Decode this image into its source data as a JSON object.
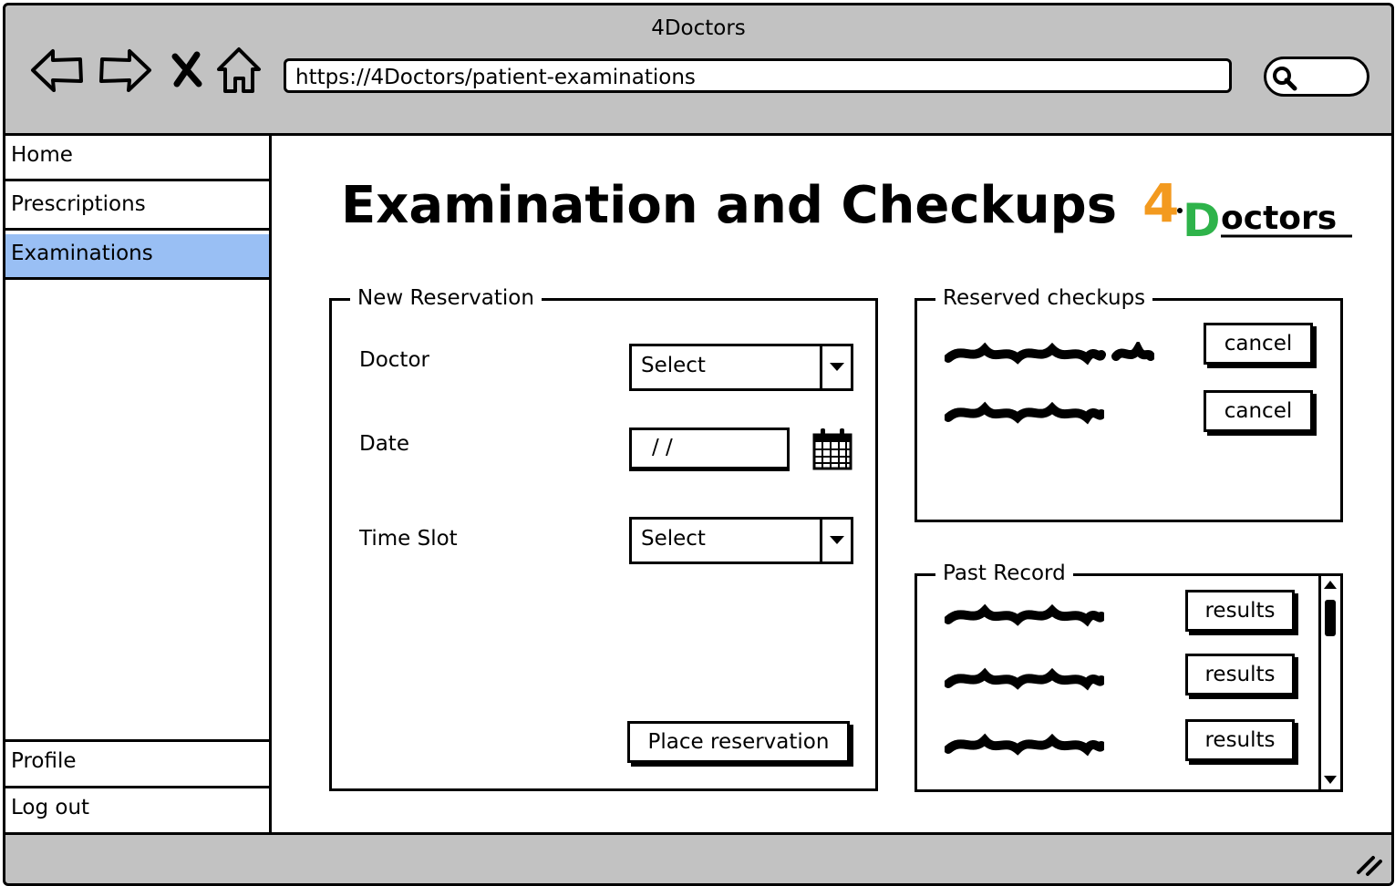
{
  "window": {
    "title": "4Doctors"
  },
  "browser": {
    "url": "https://4Doctors/patient-examinations",
    "nav_icons": [
      "back-arrow-icon",
      "forward-arrow-icon",
      "stop-icon",
      "home-icon"
    ],
    "search_icon": "search-icon"
  },
  "sidebar": {
    "items": [
      {
        "label": "Home",
        "active": false
      },
      {
        "label": "Prescriptions",
        "active": false
      },
      {
        "label": "Examinations",
        "active": true
      }
    ],
    "bottom_items": [
      {
        "label": "Profile"
      },
      {
        "label": "Log out"
      }
    ],
    "active_color": "#99bff4"
  },
  "page": {
    "title": "Examination and Checkups"
  },
  "logo": {
    "digit": "4",
    "letter": "D",
    "rest": "octors",
    "colors": {
      "digit": "#f39a1f",
      "letter": "#2eb34a",
      "rest": "#000000"
    }
  },
  "new_reservation": {
    "legend": "New Reservation",
    "doctor_label": "Doctor",
    "doctor_value": "Select",
    "date_label": "Date",
    "date_value": "/ /",
    "time_label": "Time Slot",
    "time_value": "Select",
    "submit_label": "Place reservation"
  },
  "reserved_checkups": {
    "legend": "Reserved checkups",
    "cancel_labels": [
      "cancel",
      "cancel"
    ]
  },
  "past_record": {
    "legend": "Past Record",
    "result_labels": [
      "results",
      "results",
      "results"
    ]
  }
}
